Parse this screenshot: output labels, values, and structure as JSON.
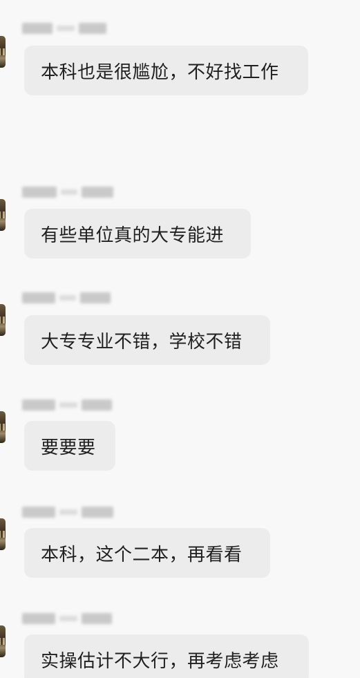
{
  "messages": [
    {
      "id": 1,
      "text": "本科也是很尴尬，不好找工作"
    },
    {
      "id": 2,
      "text": "有些单位真的大专能进"
    },
    {
      "id": 3,
      "text": "大专专业不错，学校不错"
    },
    {
      "id": 4,
      "text": "要要要"
    },
    {
      "id": 5,
      "text": "本科，这个二本，再看看"
    },
    {
      "id": 6,
      "text": "实操估计不大行，再考虑考虑"
    }
  ],
  "nickname_note": "blurred"
}
